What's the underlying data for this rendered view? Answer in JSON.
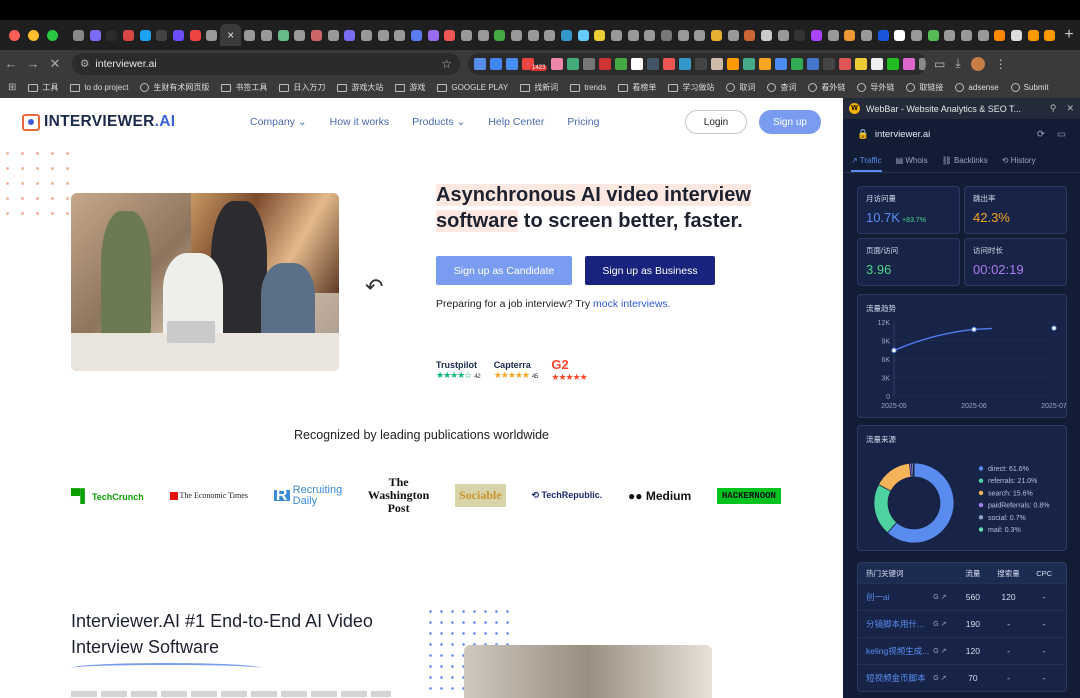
{
  "browser": {
    "tab_icon_colors": [
      "#888",
      "#7b6cf6",
      "#2a2a2a",
      "#d84545",
      "#1da1f2",
      "#444",
      "#6c4cf6",
      "#e44",
      "#999",
      "#999",
      "#999",
      "#6b8",
      "#999",
      "#c66",
      "#999",
      "#7a6cf0",
      "#999",
      "#999",
      "#999",
      "#5a7cf0",
      "#9a6cf0",
      "#e55",
      "#999",
      "#999",
      "#4a4",
      "#999",
      "#999",
      "#999",
      "#39c",
      "#6cf",
      "#ec3",
      "#999",
      "#999",
      "#999",
      "#777",
      "#999",
      "#999",
      "#e8b030",
      "#999",
      "#c63",
      "#ccc",
      "#999",
      "#333",
      "#a4f",
      "#999",
      "#e93",
      "#999",
      "#1a56db",
      "#fff",
      "#999",
      "#5b5",
      "#999",
      "#999",
      "#999",
      "#f80",
      "#ddd",
      "#f90",
      "#f90"
    ],
    "active_tab_close": "×",
    "new_tab": "+",
    "url": "interviewer.ai",
    "ext_badge": "1423",
    "ext_icon_colors": [
      "#5a8cf0",
      "#4285f4",
      "#4a8cf0",
      "#e44",
      "#e8a",
      "#4a7",
      "#777",
      "#c33",
      "#4a4",
      "#fff",
      "#456",
      "#e55",
      "#39c",
      "#444",
      "#cba",
      "#f90",
      "#4a8",
      "#f5a623",
      "#4a8cf0",
      "#3a5",
      "#47c",
      "#444",
      "#d55",
      "#ec3",
      "#eee",
      "#2b2",
      "#d6c",
      "#888",
      "#aaa"
    ],
    "bookmarks": [
      {
        "icon": "folder",
        "label": "工具"
      },
      {
        "icon": "folder",
        "label": "to do project"
      },
      {
        "icon": "globe",
        "label": "生财有术网页版"
      },
      {
        "icon": "folder",
        "label": "书签工具"
      },
      {
        "icon": "folder",
        "label": "日入万刀"
      },
      {
        "icon": "folder",
        "label": "游戏大站"
      },
      {
        "icon": "folder",
        "label": "游戏"
      },
      {
        "icon": "folder",
        "label": "GOOGLE PLAY"
      },
      {
        "icon": "folder",
        "label": "找新词"
      },
      {
        "icon": "folder",
        "label": "trends"
      },
      {
        "icon": "folder",
        "label": "看榜单"
      },
      {
        "icon": "folder",
        "label": "学习做站"
      },
      {
        "icon": "globe",
        "label": "取词"
      },
      {
        "icon": "globe",
        "label": "查词"
      },
      {
        "icon": "globe",
        "label": "看外链"
      },
      {
        "icon": "globe",
        "label": "导外链"
      },
      {
        "icon": "globe",
        "label": "取链接"
      },
      {
        "icon": "globe",
        "label": "adsense"
      },
      {
        "icon": "globe",
        "label": "Submit"
      }
    ]
  },
  "site": {
    "logo_main": "INTERVIEWER",
    "logo_suffix": ".AI",
    "nav": [
      "Company ⌄",
      "How it works",
      "Products ⌄",
      "Help Center",
      "Pricing"
    ],
    "login": "Login",
    "signup": "Sign up",
    "hero_highlight": "Asynchronous AI video interview software",
    "hero_rest": " to screen better, faster.",
    "cta_candidate": "Sign up as Candidate",
    "cta_business": "Sign up as Business",
    "prep_text": "Preparing for a job interview? Try ",
    "prep_link": "mock interviews.",
    "ratings": [
      {
        "name": "Trustpilot",
        "stars": "★★★★☆",
        "score": "4.2"
      },
      {
        "name": "Capterra",
        "stars": "★★★★★",
        "score": "4.5"
      },
      {
        "name": "G2",
        "stars": "★★★★★",
        "score": ""
      }
    ],
    "recognized": "Recognized by leading publications worldwide",
    "pubs": {
      "techcrunch": "TechCrunch",
      "economist": "The Economic Times",
      "recruiting_1": "Recruiting",
      "recruiting_2": "Daily",
      "wapo_1": "The",
      "wapo_2": "Washington",
      "wapo_3": "Post",
      "sociable": "Sociable",
      "techrepublic": "TechRepublic.",
      "medium": "Medium",
      "hackernoon": "HACKERNOON"
    },
    "section_title": "Interviewer.AI #1 End-to-End AI Video Interview Software"
  },
  "webbar": {
    "title": "WebBar - Website Analytics & SEO T...",
    "domain": "interviewer.ai",
    "tabs": [
      "Traffic",
      "Whois",
      "Backlinks",
      "History"
    ],
    "metrics": [
      {
        "label": "月访问量",
        "value": "10.7K",
        "delta": "+83.7%",
        "color": "#5a8cf0"
      },
      {
        "label": "跳出率",
        "value": "42.3%",
        "delta": "",
        "color": "#f5a623"
      },
      {
        "label": "页面/访问",
        "value": "3.96",
        "delta": "",
        "color": "#4ed38a"
      },
      {
        "label": "访问时长",
        "value": "00:02:19",
        "delta": "",
        "color": "#b07cf0"
      }
    ],
    "trend_title": "流量趋势",
    "source_title": "流量来源",
    "keywords_title": "热门关键词",
    "kw_cols": [
      "流量",
      "搜索量",
      "CPC"
    ],
    "keywords": [
      {
        "kw": "创一ai",
        "traffic": "560",
        "volume": "120",
        "cpc": "-"
      },
      {
        "kw": "分镜脚本用什...",
        "traffic": "190",
        "volume": "-",
        "cpc": "-"
      },
      {
        "kw": "keling视频生成...",
        "traffic": "120",
        "volume": "-",
        "cpc": "-"
      },
      {
        "kw": "短视频金币脚本",
        "traffic": "70",
        "volume": "-",
        "cpc": "-"
      }
    ]
  },
  "chart_data": [
    {
      "type": "line",
      "title": "流量趋势",
      "x": [
        "2025-05",
        "2025-06",
        "2025-07"
      ],
      "series": [
        {
          "values": [
            7400,
            10800,
            11000
          ]
        }
      ],
      "yticks": [
        "0",
        "3K",
        "6K",
        "9K",
        "12K"
      ],
      "ylim": [
        0,
        12000
      ]
    },
    {
      "type": "pie",
      "title": "流量来源",
      "labels": [
        "direct: 61.6%",
        "referrals: 21.0%",
        "search: 15.6%",
        "paidReferrals: 0.8%",
        "social: 0.7%",
        "mail: 0.3%"
      ],
      "values": [
        61.6,
        21.0,
        15.6,
        0.8,
        0.7,
        0.3
      ],
      "colors": [
        "#5a8cf0",
        "#4ed3a0",
        "#f5b45a",
        "#a07cf0",
        "#8fa0d0",
        "#66ddaa"
      ],
      "legend": "right"
    }
  ]
}
